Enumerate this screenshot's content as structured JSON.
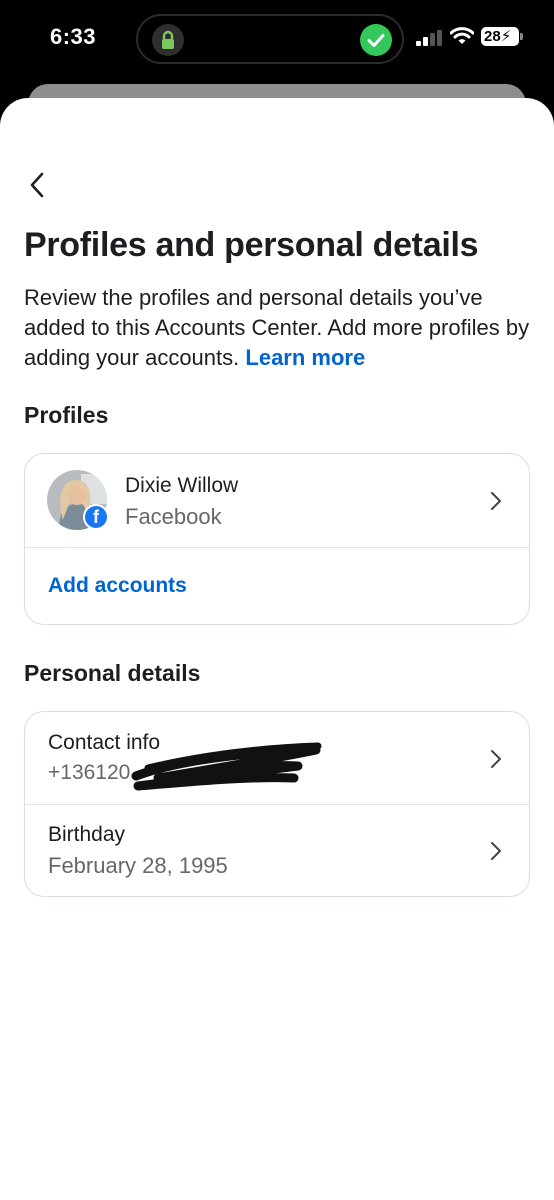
{
  "status_bar": {
    "time": "6:33",
    "battery": "28"
  },
  "header": {
    "title": "Profiles and personal details",
    "description": "Review the profiles and personal details you’ve added to this Accounts Center. Add more profiles by adding your accounts.",
    "learn_more": "Learn more"
  },
  "profiles": {
    "heading": "Profiles",
    "items": [
      {
        "name": "Dixie Willow",
        "platform": "Facebook"
      }
    ],
    "add_accounts": "Add accounts"
  },
  "personal_details": {
    "heading": "Personal details",
    "items": [
      {
        "label": "Contact info",
        "value": "+136120"
      },
      {
        "label": "Birthday",
        "value": "February 28, 1995"
      }
    ]
  },
  "colors": {
    "link": "#0064d1",
    "facebook": "#1877f2",
    "check": "#34c759"
  }
}
